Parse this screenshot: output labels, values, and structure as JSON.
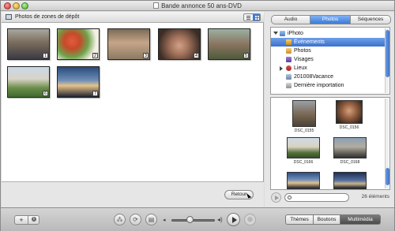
{
  "window": {
    "title": "Bande annonce 50 ans-DVD"
  },
  "drop_zone": {
    "title": "Photos de zones de dépôt",
    "items": [
      {
        "number": "1"
      },
      {
        "number": "2"
      },
      {
        "number": "3"
      },
      {
        "number": "4"
      },
      {
        "number": "5"
      },
      {
        "number": "6"
      },
      {
        "number": "7"
      }
    ],
    "back_button": "Retour"
  },
  "browser": {
    "tabs": [
      "Audio",
      "Photos",
      "Séquences"
    ],
    "active_tab": "Photos",
    "sources": [
      {
        "label": "iPhoto",
        "icon": "iphoto-icon"
      },
      {
        "label": "Événements",
        "icon": "events-icon",
        "selected": true
      },
      {
        "label": "Photos",
        "icon": "photos-icon"
      },
      {
        "label": "Visages",
        "icon": "faces-icon"
      },
      {
        "label": "Lieux",
        "icon": "places-icon"
      },
      {
        "label": "201008Vacance",
        "icon": "event-icon"
      },
      {
        "label": "Dernière importation",
        "icon": "last-import-icon"
      }
    ],
    "media": [
      {
        "label": "DSC_0155"
      },
      {
        "label": "DSC_0156"
      },
      {
        "label": "DSC_0166"
      },
      {
        "label": "DSC_0168"
      },
      {
        "label": ""
      },
      {
        "label": ""
      }
    ],
    "count": "26 éléments"
  },
  "toolbar": {
    "add_label": "+",
    "tabs": [
      "Thèmes",
      "Boutons",
      "Multimédia"
    ],
    "active_tab": "Multimédia"
  }
}
